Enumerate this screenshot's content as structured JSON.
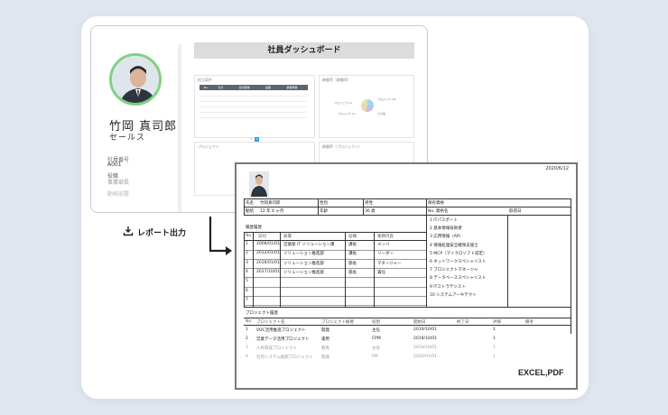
{
  "dashboard": {
    "title": "社員ダッシュボード",
    "profile": {
      "name": "竹岡 真司郎",
      "department": "セールス",
      "fields": [
        {
          "label": "社員番号",
          "value": "A001"
        },
        {
          "label": "役職",
          "value": "事業部長"
        },
        {
          "label": "勤務部署",
          "value": ""
        }
      ]
    },
    "panels": {
      "project_title": "担当案件",
      "pie_title": "稼働率（稼働率）",
      "bottom_left_title": "プロジェクト",
      "bottom_right_title": "稼働率（プロジェクト）",
      "pager": [
        "1",
        "2"
      ],
      "pie_labels": [
        "プロジェクトA",
        "プロジェクトB",
        "プロジェクトC",
        "その他"
      ],
      "table_headers": [
        "No.",
        "日付",
        "担当部署",
        "役職",
        "部署概要"
      ]
    }
  },
  "export": {
    "label": "レポート出力"
  },
  "report": {
    "date": "2020/6/12",
    "header": {
      "name_label": "氏名",
      "name_value": "竹岡真司郎",
      "gender_label": "性別",
      "gender_value": "男性",
      "qual_label": "保有資格",
      "tenure_label": "勤続",
      "tenure_value": "12 年 6 ヶ月",
      "age_label": "年齢",
      "age_value": "36 歳",
      "cert_label": "No. 資格名",
      "cert_date_label": "取得日"
    },
    "history_title": "職歴履歴",
    "history_headers": [
      "No.",
      "日付",
      "部署",
      "役職",
      "業務内容"
    ],
    "history_rows": [
      [
        "1",
        "2008/01/01",
        "営業部 IT ソリューション課",
        "課長",
        "メンバ"
      ],
      [
        "2",
        "2012/01/01",
        "ソリューション推進部",
        "課長",
        "リーダー"
      ],
      [
        "3",
        "2016/01/01",
        "ソリューション推進部",
        "部長",
        "マネージャー"
      ],
      [
        "4",
        "2017/10/01",
        "ソリューション推進部",
        "部長",
        "責任"
      ],
      [
        "5",
        "",
        "",
        "",
        ""
      ],
      [
        "6",
        "",
        "",
        "",
        ""
      ],
      [
        "7",
        "",
        "",
        "",
        ""
      ]
    ],
    "certs": [
      "1 ITパスポート",
      "2 基本情報技術者",
      "3 応用情報（AP）",
      "4 情報処理安全確保支援士",
      "5 MCP（マイクロソフト認定）",
      "6 ネットワークスペシャリスト",
      "7 プロジェクトマネージャ",
      "8 データベーススペシャリスト",
      "9 ITストラテジスト",
      "10 システムアーキテクト"
    ],
    "project_title": "プロジェクト履歴",
    "project_headers": [
      "No.",
      "プロジェクト名",
      "プロジェクト概要",
      "役割",
      "開始日",
      "終了日",
      "評価",
      "備考"
    ],
    "project_rows": [
      [
        "1",
        "VOC活用推進プロジェクト",
        "開発",
        "主任",
        "2019/10/01",
        "",
        "1",
        ""
      ],
      [
        "2",
        "営業データ活用プロジェクト",
        "運用",
        "CPM",
        "2019/10/01",
        "",
        "1",
        ""
      ],
      [
        "3",
        "人材育成プロジェクト",
        "教育",
        "主任",
        "2019/10/01",
        "",
        "1",
        ""
      ],
      [
        "4",
        "社内システム刷新プロジェクト",
        "開発",
        "PM",
        "2020/01/01",
        "",
        "1",
        ""
      ]
    ],
    "format_label": "EXCEL,PDF"
  }
}
